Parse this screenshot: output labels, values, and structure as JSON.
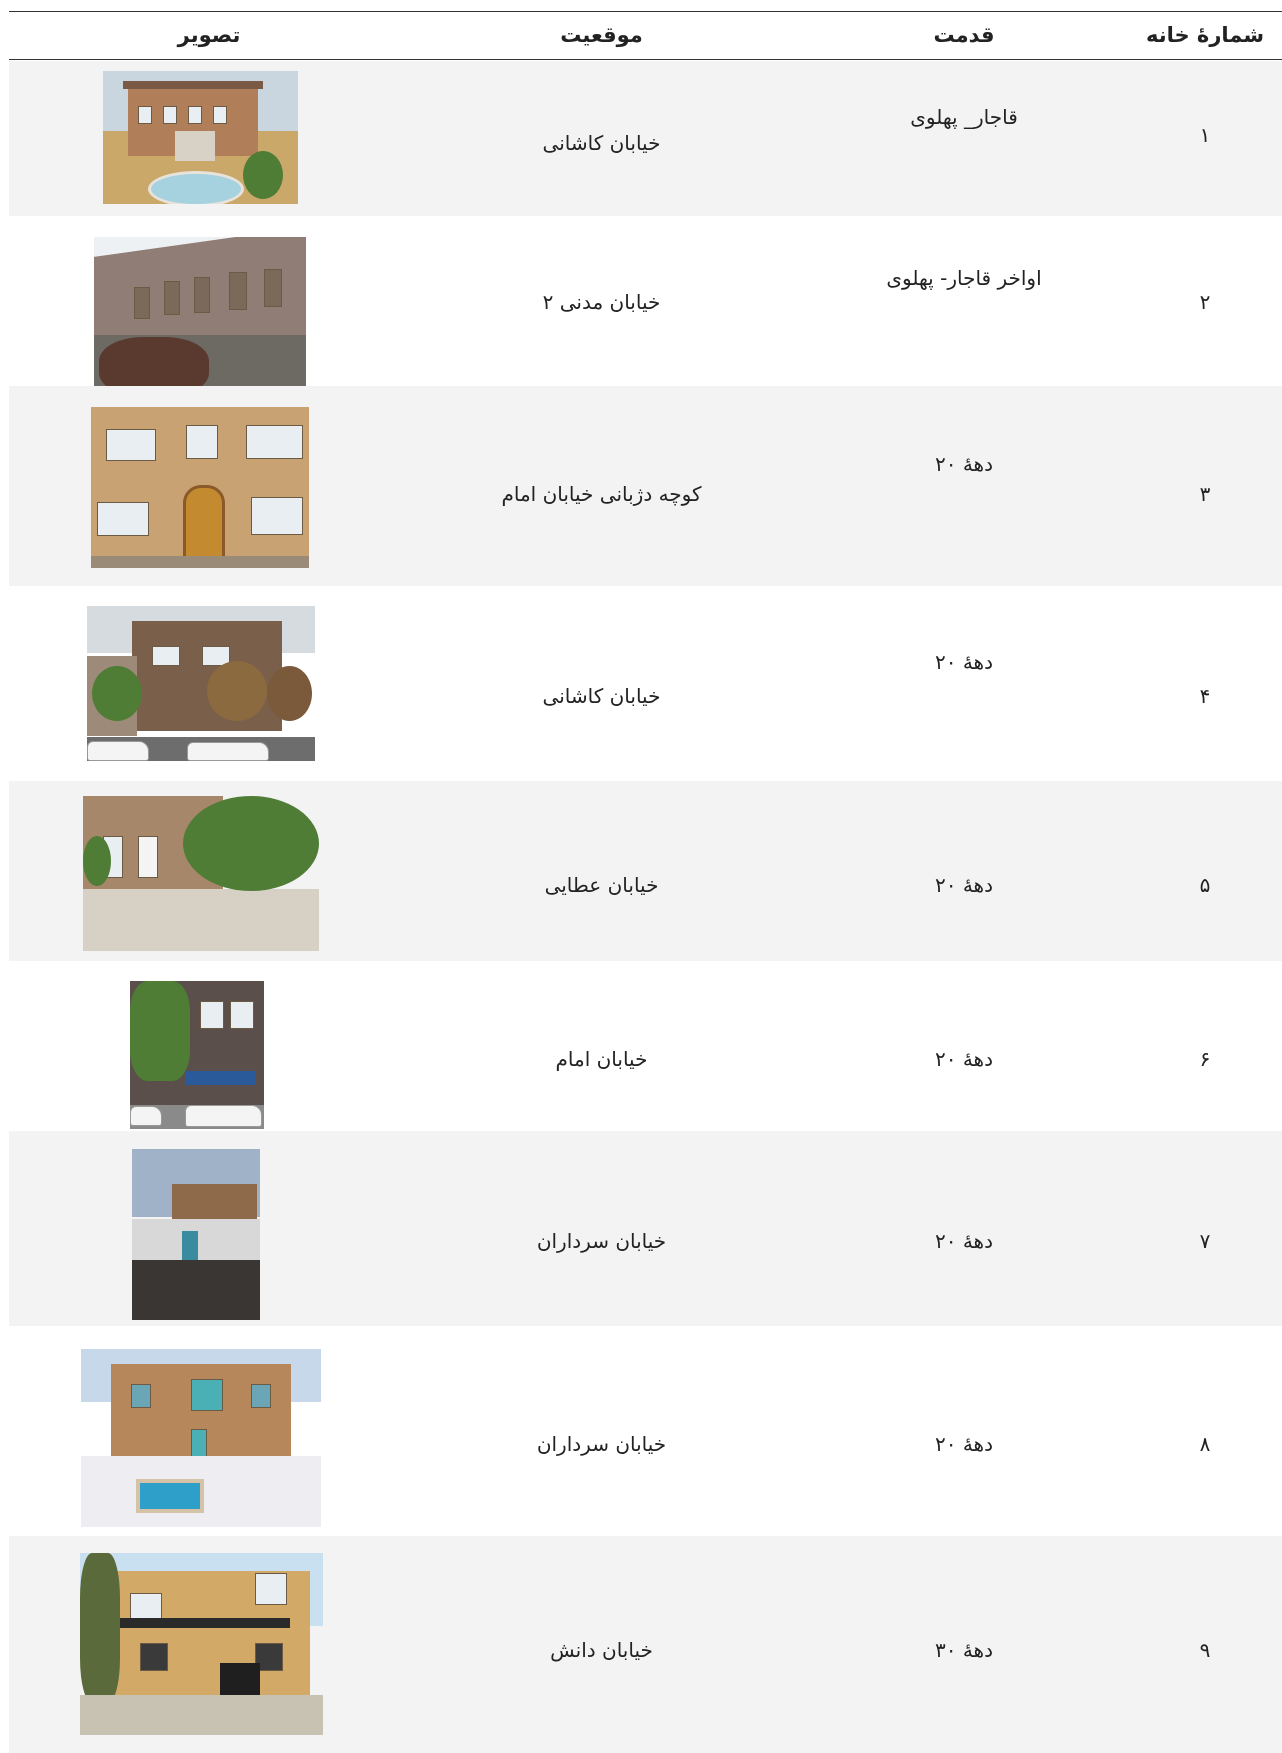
{
  "table": {
    "headers": {
      "number": "شمارهٔ خانه",
      "age": "قدمت",
      "location": "موقعیت",
      "image": "تصویر"
    },
    "rows": [
      {
        "number": "۱",
        "age": "قاجار_ پهلوی",
        "location": "خیابان کاشانی"
      },
      {
        "number": "۲",
        "age": "اواخر قاجار- پهلوی",
        "location": "خیابان مدنی ۲"
      },
      {
        "number": "۳",
        "age": "دههٔ ۲۰",
        "location": "کوچه دژبانی خیابان امام"
      },
      {
        "number": "۴",
        "age": "دههٔ ۲۰",
        "location": "خیابان کاشانی"
      },
      {
        "number": "۵",
        "age": "دههٔ ۲۰",
        "location": "خیابان عطایی"
      },
      {
        "number": "۶",
        "age": "دههٔ ۲۰",
        "location": "خیابان امام"
      },
      {
        "number": "۷",
        "age": "دههٔ ۲۰",
        "location": "خیابان سرداران"
      },
      {
        "number": "۸",
        "age": "دههٔ ۲۰",
        "location": "خیابان سرداران"
      },
      {
        "number": "۹",
        "age": "دههٔ ۳۰",
        "location": "خیابان دانش"
      }
    ]
  },
  "colors": {
    "rule": "#333333",
    "shade": "#f3f3f3",
    "brick": "#b48a5c"
  }
}
